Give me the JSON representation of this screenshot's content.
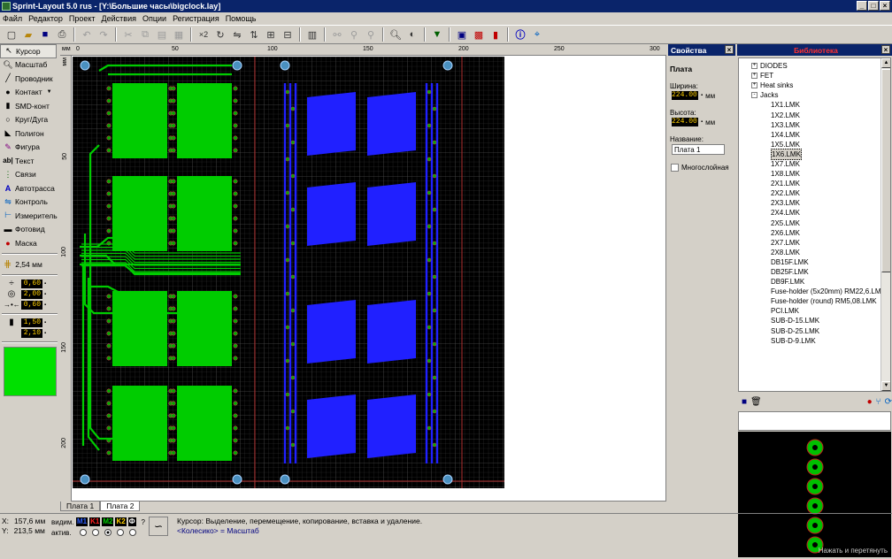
{
  "window": {
    "title": "Sprint-Layout 5.0 rus   - [Y:\\Большие часы\\bigclock.lay]"
  },
  "menu": [
    "Файл",
    "Редактор",
    "Проект",
    "Действия",
    "Опции",
    "Регистрация",
    "Помощь"
  ],
  "toolbar": {
    "zoom_label": "×2"
  },
  "tools": [
    {
      "label": "Курсор",
      "icon": "cursor-icon"
    },
    {
      "label": "Масштаб",
      "icon": "zoom-icon"
    },
    {
      "label": "Проводник",
      "icon": "track-icon"
    },
    {
      "label": "Контакт",
      "icon": "pad-icon"
    },
    {
      "label": "SMD-конт",
      "icon": "smd-icon"
    },
    {
      "label": "Круг/Дуга",
      "icon": "circle-icon"
    },
    {
      "label": "Полигон",
      "icon": "polygon-icon"
    },
    {
      "label": "Фигура",
      "icon": "shape-icon"
    },
    {
      "label": "Текст",
      "icon": "text-icon"
    },
    {
      "label": "Связи",
      "icon": "connections-icon"
    },
    {
      "label": "Автотрасса",
      "icon": "autoroute-icon"
    },
    {
      "label": "Контроль",
      "icon": "check-icon"
    },
    {
      "label": "Измеритель",
      "icon": "measure-icon"
    },
    {
      "label": "Фотовид",
      "icon": "photoview-icon"
    },
    {
      "label": "Маска",
      "icon": "mask-icon"
    }
  ],
  "grid": {
    "value": "2,54 мм"
  },
  "sizes": {
    "track_width": "0,60",
    "pad_outer": "2,00",
    "pad_inner": "0,60",
    "smd_w": "1,50",
    "smd_h": "2,10"
  },
  "colors": {
    "swatch": "#00e000",
    "board_bg": "#000000",
    "top_copper": "#2020ff",
    "bottom_copper": "#00cc00"
  },
  "rulers": {
    "top": [
      "0",
      "50",
      "100",
      "150",
      "200",
      "250",
      "300"
    ],
    "left": [
      "50",
      "100",
      "150",
      "200"
    ],
    "unit_top": "мм",
    "unit_left": "мм"
  },
  "tabs": [
    "Плата 1",
    "Плата 2"
  ],
  "properties": {
    "title": "Свойства",
    "section": "Плата",
    "width_label": "Ширина:",
    "width_value": "224.00",
    "width_unit": "мм",
    "height_label": "Высота:",
    "height_value": "224.00",
    "height_unit": "мм",
    "name_label": "Название:",
    "name_value": "Плата 1",
    "multilayer_label": "Многослойная"
  },
  "library": {
    "title": "Библиотека",
    "items": [
      {
        "label": "DIODES",
        "level": 1,
        "expander": "+"
      },
      {
        "label": "FET",
        "level": 1,
        "expander": "+"
      },
      {
        "label": "Heat sinks",
        "level": 1,
        "expander": "+"
      },
      {
        "label": "Jacks",
        "level": 1,
        "expander": "-"
      },
      {
        "label": "1X1.LMK",
        "level": 2
      },
      {
        "label": "1X2.LMK",
        "level": 2
      },
      {
        "label": "1X3.LMK",
        "level": 2
      },
      {
        "label": "1X4.LMK",
        "level": 2
      },
      {
        "label": "1X5.LMK",
        "level": 2
      },
      {
        "label": "1X6.LMK",
        "level": 2,
        "selected": true
      },
      {
        "label": "1X7.LMK",
        "level": 2
      },
      {
        "label": "1X8.LMK",
        "level": 2
      },
      {
        "label": "2X1.LMK",
        "level": 2
      },
      {
        "label": "2X2.LMK",
        "level": 2
      },
      {
        "label": "2X3.LMK",
        "level": 2
      },
      {
        "label": "2X4.LMK",
        "level": 2
      },
      {
        "label": "2X5.LMK",
        "level": 2
      },
      {
        "label": "2X6.LMK",
        "level": 2
      },
      {
        "label": "2X7.LMK",
        "level": 2
      },
      {
        "label": "2X8.LMK",
        "level": 2
      },
      {
        "label": "DB15F.LMK",
        "level": 2
      },
      {
        "label": "DB25F.LMK",
        "level": 2
      },
      {
        "label": "DB9F.LMK",
        "level": 2
      },
      {
        "label": "Fuse-holder (5x20mm) RM22,6.LMK",
        "level": 2
      },
      {
        "label": "Fuse-holder (round) RM5,08.LMK",
        "level": 2
      },
      {
        "label": "PCI.LMK",
        "level": 2
      },
      {
        "label": "SUB-D-15.LMK",
        "level": 2
      },
      {
        "label": "SUB-D-25.LMK",
        "level": 2
      },
      {
        "label": "SUB-D-9.LMK",
        "level": 2
      }
    ],
    "preview_hint": "Нажать и перетянуть"
  },
  "status": {
    "x_label": "X:",
    "x_value": "157,6 мм",
    "y_label": "Y:",
    "y_value": "213,5 мм",
    "visible_label": "видим.",
    "active_label": "актив.",
    "layers": [
      {
        "label": "M1",
        "color": "#3060ff"
      },
      {
        "label": "K1",
        "color": "#ff2020"
      },
      {
        "label": "M2",
        "color": "#00d000"
      },
      {
        "label": "K2",
        "color": "#ffd000"
      },
      {
        "label": "Ф",
        "color": "#ffffff"
      }
    ],
    "help_mark": "?",
    "message_line1": "Курсор: Выделение, перемещение, копирование, вставка и удаление.",
    "message_line2": "<Колесико> = Масштаб"
  }
}
